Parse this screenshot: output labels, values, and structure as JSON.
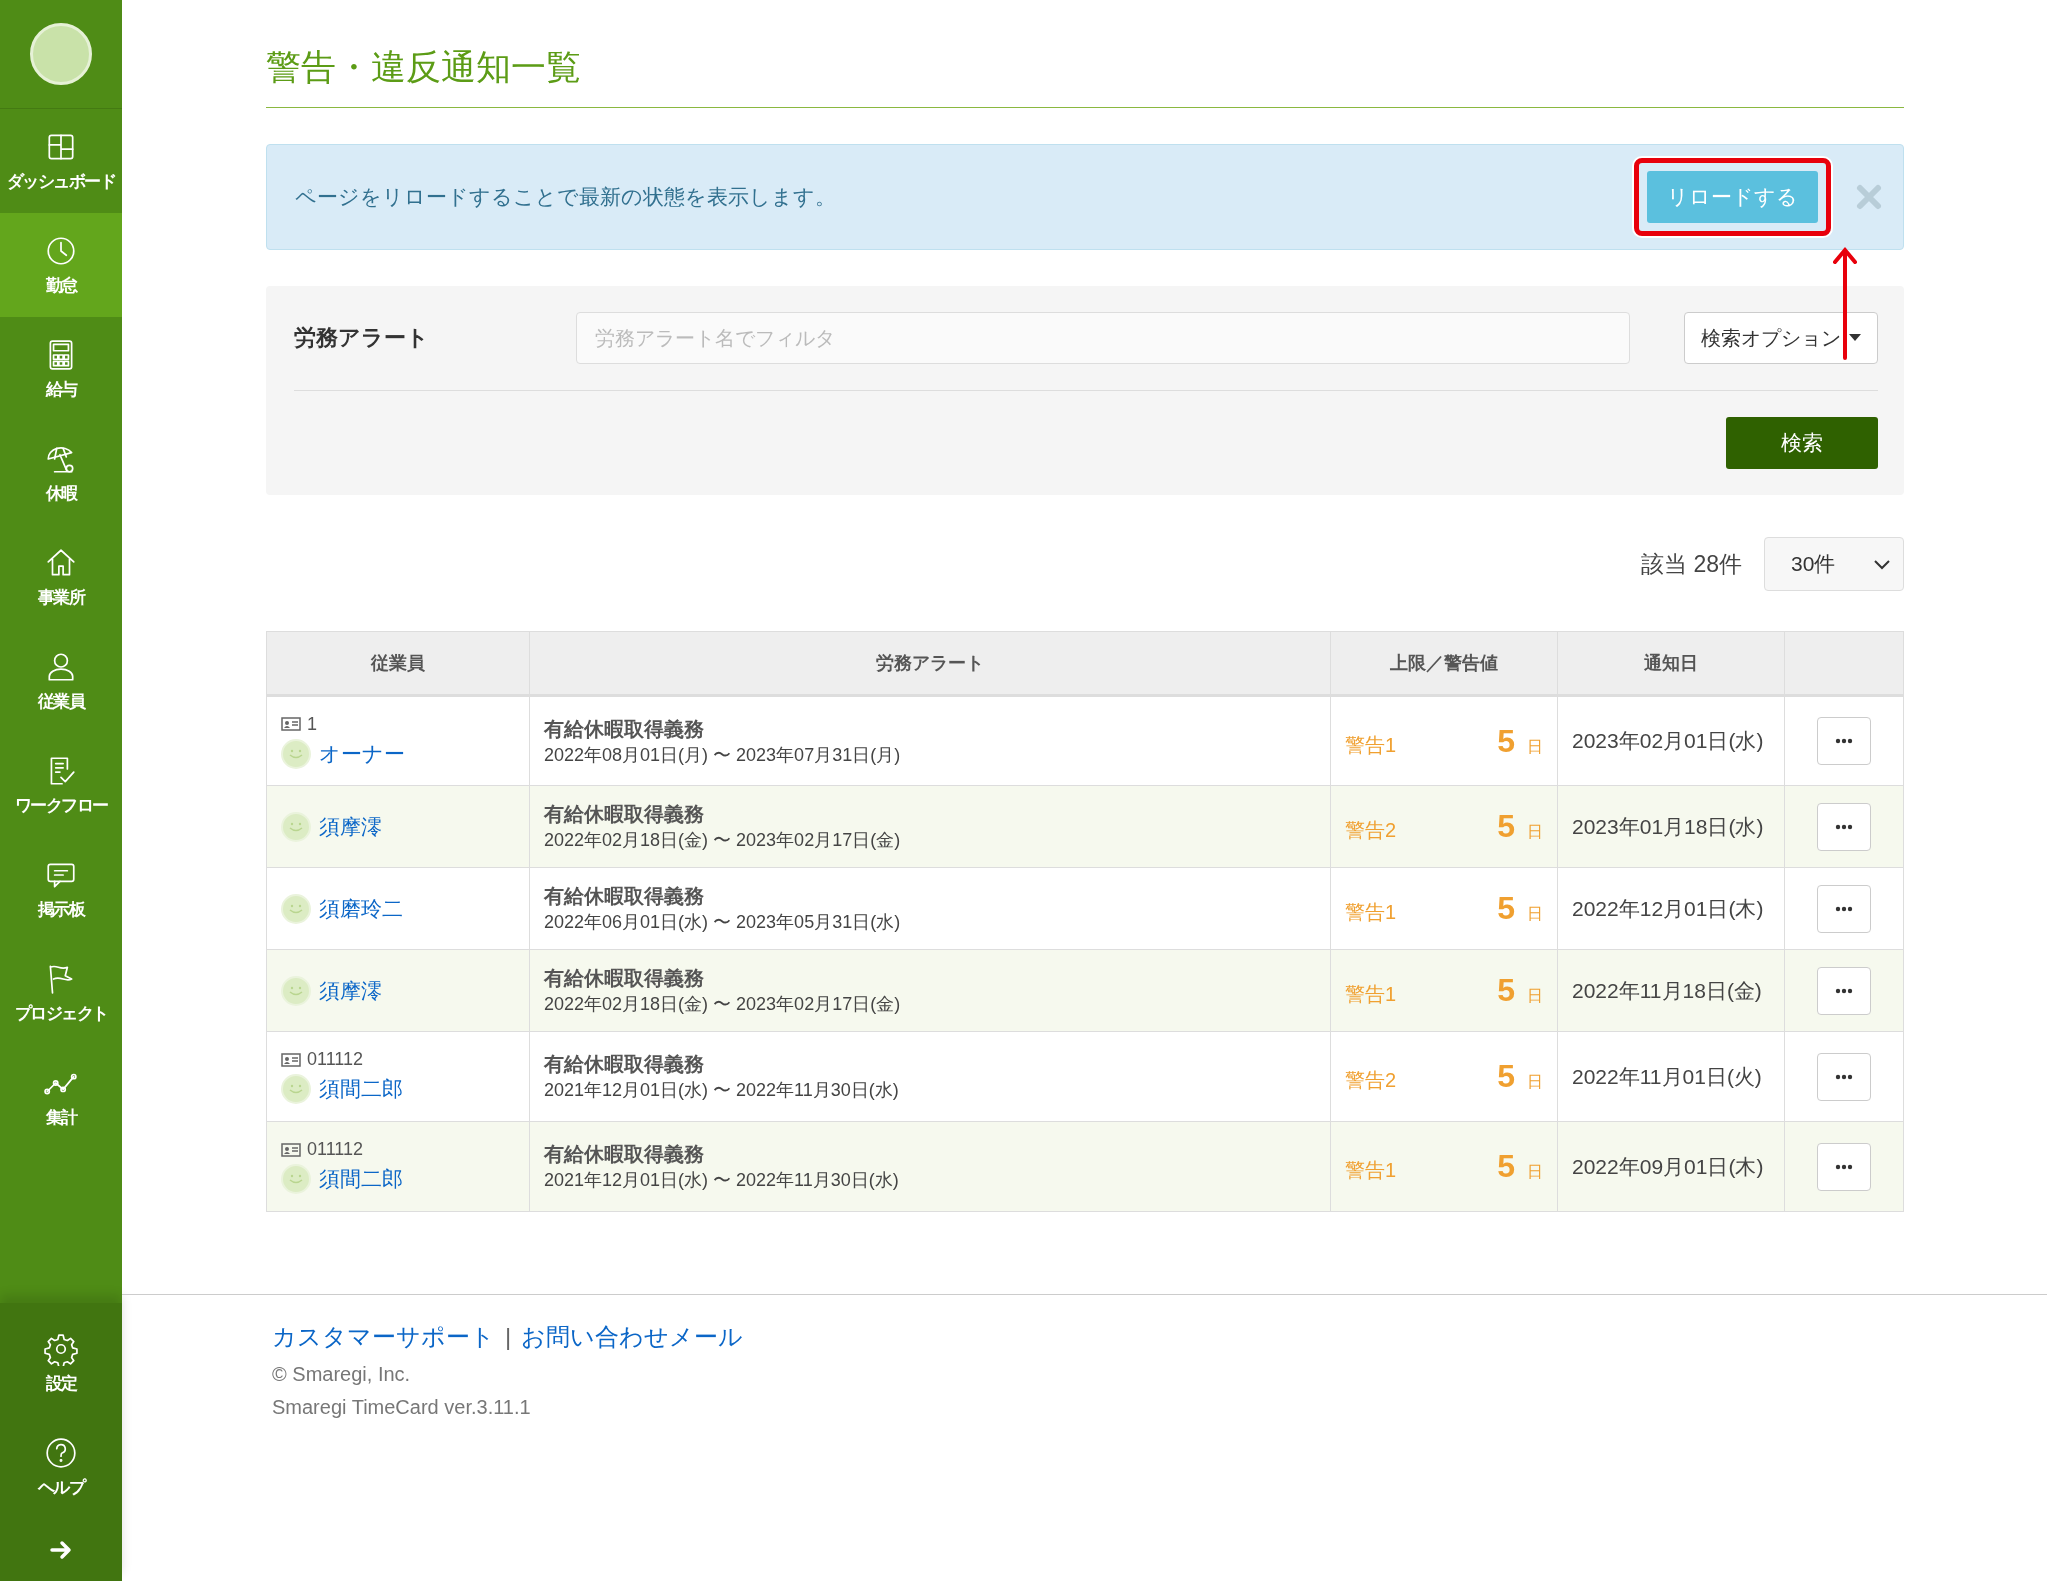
{
  "sidebar": {
    "items": [
      {
        "label": "ダッシュボード",
        "selected": false
      },
      {
        "label": "勤怠",
        "selected": true
      },
      {
        "label": "給与",
        "selected": false
      },
      {
        "label": "休暇",
        "selected": false
      },
      {
        "label": "事業所",
        "selected": false
      },
      {
        "label": "従業員",
        "selected": false
      },
      {
        "label": "ワークフロー",
        "selected": false
      },
      {
        "label": "掲示板",
        "selected": false
      },
      {
        "label": "プロジェクト",
        "selected": false
      },
      {
        "label": "集計",
        "selected": false
      }
    ],
    "bottom_items": [
      {
        "label": "設定",
        "selected": false
      },
      {
        "label": "ヘルプ",
        "selected": false
      }
    ]
  },
  "page_title": "警告・違反通知一覧",
  "alert": {
    "message": "ページをリロードすることで最新の状態を表示します。",
    "reload_button": {
      "label": "リロードする",
      "highlighted": true
    }
  },
  "filter": {
    "label": "労務アラート",
    "placeholder": "労務アラート名でフィルタ",
    "options_button": "検索オプション",
    "search_button": "検索"
  },
  "result_count": "該当 28件",
  "page_size": "30件",
  "table": {
    "columns": [
      "従業員",
      "労務アラート",
      "上限／警告値",
      "通知日"
    ],
    "rows": [
      {
        "code": "1",
        "name": "オーナー",
        "alert": "有給休暇取得義務",
        "period": "2022年08月01日(月) 〜 2023年07月31日(月)",
        "level": "警告1",
        "value": "5",
        "unit": "日",
        "date": "2023年02月01日(水)"
      },
      {
        "name": "須摩澪",
        "alert": "有給休暇取得義務",
        "period": "2022年02月18日(金) 〜 2023年02月17日(金)",
        "level": "警告2",
        "value": "5",
        "unit": "日",
        "date": "2023年01月18日(水)"
      },
      {
        "name": "須磨玲二",
        "alert": "有給休暇取得義務",
        "period": "2022年06月01日(水) 〜 2023年05月31日(水)",
        "level": "警告1",
        "value": "5",
        "unit": "日",
        "date": "2022年12月01日(木)"
      },
      {
        "name": "須摩澪",
        "alert": "有給休暇取得義務",
        "period": "2022年02月18日(金) 〜 2023年02月17日(金)",
        "level": "警告1",
        "value": "5",
        "unit": "日",
        "date": "2022年11月18日(金)"
      },
      {
        "code": "011112",
        "name": "須間二郎",
        "alert": "有給休暇取得義務",
        "period": "2021年12月01日(水) 〜 2022年11月30日(水)",
        "level": "警告2",
        "value": "5",
        "unit": "日",
        "date": "2022年11月01日(火)"
      },
      {
        "code": "011112",
        "name": "須間二郎",
        "alert": "有給休暇取得義務",
        "period": "2021年12月01日(水) 〜 2022年11月30日(水)",
        "level": "警告1",
        "value": "5",
        "unit": "日",
        "date": "2022年09月01日(木)"
      }
    ]
  },
  "footer": {
    "links": [
      "カスタマーサポート",
      "お問い合わせメール"
    ],
    "separator": "|",
    "copyright": "© Smaregi, Inc.",
    "version": "Smaregi TimeCard ver.3.11.1"
  }
}
